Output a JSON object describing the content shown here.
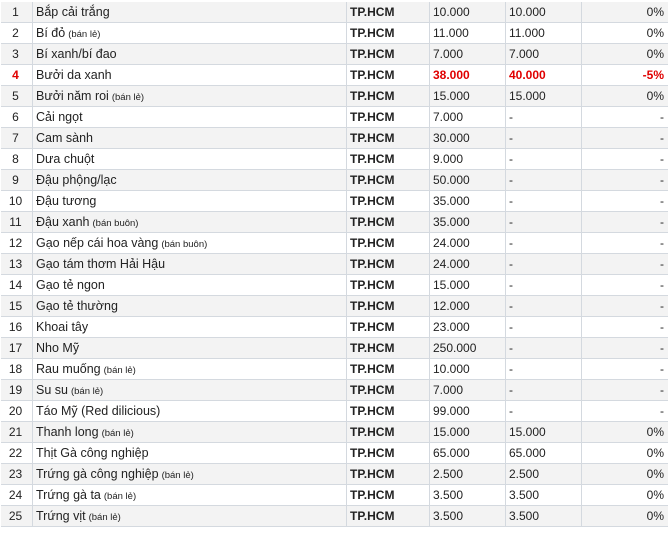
{
  "table": {
    "rows": [
      {
        "idx": "1",
        "name": "Bắp cải trắng",
        "note": "",
        "loc": "TP.HCM",
        "price1": "10.000",
        "price2": "10.000",
        "change": "0%"
      },
      {
        "idx": "2",
        "name": "Bí đỏ",
        "note": "(bán lẻ)",
        "loc": "TP.HCM",
        "price1": "11.000",
        "price2": "11.000",
        "change": "0%"
      },
      {
        "idx": "3",
        "name": "Bí xanh/bí đao",
        "note": "",
        "loc": "TP.HCM",
        "price1": "7.000",
        "price2": "7.000",
        "change": "0%"
      },
      {
        "idx": "4",
        "name": "Bưởi da xanh",
        "note": "",
        "loc": "TP.HCM",
        "price1": "38.000",
        "price2": "40.000",
        "change": "-5%",
        "highlight": true
      },
      {
        "idx": "5",
        "name": "Bưởi năm roi",
        "note": "(bán lẻ)",
        "loc": "TP.HCM",
        "price1": "15.000",
        "price2": "15.000",
        "change": "0%"
      },
      {
        "idx": "6",
        "name": "Cải ngọt",
        "note": "",
        "loc": "TP.HCM",
        "price1": "7.000",
        "price2": "-",
        "change": "-"
      },
      {
        "idx": "7",
        "name": "Cam sành",
        "note": "",
        "loc": "TP.HCM",
        "price1": "30.000",
        "price2": "-",
        "change": "-"
      },
      {
        "idx": "8",
        "name": "Dưa chuột",
        "note": "",
        "loc": "TP.HCM",
        "price1": "9.000",
        "price2": "-",
        "change": "-"
      },
      {
        "idx": "9",
        "name": "Đậu phộng/lạc",
        "note": "",
        "loc": "TP.HCM",
        "price1": "50.000",
        "price2": "-",
        "change": "-"
      },
      {
        "idx": "10",
        "name": "Đậu tương",
        "note": "",
        "loc": "TP.HCM",
        "price1": "35.000",
        "price2": "-",
        "change": "-"
      },
      {
        "idx": "11",
        "name": "Đậu xanh",
        "note": "(bán buôn)",
        "loc": "TP.HCM",
        "price1": "35.000",
        "price2": "-",
        "change": "-"
      },
      {
        "idx": "12",
        "name": "Gạo nếp cái hoa vàng",
        "note": "(bán buôn)",
        "loc": "TP.HCM",
        "price1": "24.000",
        "price2": "-",
        "change": "-"
      },
      {
        "idx": "13",
        "name": "Gạo tám thơm Hải Hậu",
        "note": "",
        "loc": "TP.HCM",
        "price1": "24.000",
        "price2": "-",
        "change": "-"
      },
      {
        "idx": "14",
        "name": "Gạo tẻ ngon",
        "note": "",
        "loc": "TP.HCM",
        "price1": "15.000",
        "price2": "-",
        "change": "-"
      },
      {
        "idx": "15",
        "name": "Gạo tẻ thường",
        "note": "",
        "loc": "TP.HCM",
        "price1": "12.000",
        "price2": "-",
        "change": "-"
      },
      {
        "idx": "16",
        "name": "Khoai tây",
        "note": "",
        "loc": "TP.HCM",
        "price1": "23.000",
        "price2": "-",
        "change": "-"
      },
      {
        "idx": "17",
        "name": "Nho Mỹ",
        "note": "",
        "loc": "TP.HCM",
        "price1": "250.000",
        "price2": "-",
        "change": "-"
      },
      {
        "idx": "18",
        "name": "Rau muống",
        "note": "(bán lẻ)",
        "loc": "TP.HCM",
        "price1": "10.000",
        "price2": "-",
        "change": "-"
      },
      {
        "idx": "19",
        "name": "Su su",
        "note": "(bán lẻ)",
        "loc": "TP.HCM",
        "price1": "7.000",
        "price2": "-",
        "change": "-"
      },
      {
        "idx": "20",
        "name": "Táo Mỹ (Red dilicious)",
        "note": "",
        "loc": "TP.HCM",
        "price1": "99.000",
        "price2": "-",
        "change": "-"
      },
      {
        "idx": "21",
        "name": "Thanh long",
        "note": "(bán lẻ)",
        "loc": "TP.HCM",
        "price1": "15.000",
        "price2": "15.000",
        "change": "0%"
      },
      {
        "idx": "22",
        "name": "Thịt Gà công nghiệp",
        "note": "",
        "loc": "TP.HCM",
        "price1": "65.000",
        "price2": "65.000",
        "change": "0%"
      },
      {
        "idx": "23",
        "name": "Trứng gà công nghiệp",
        "note": "(bán lẻ)",
        "loc": "TP.HCM",
        "price1": "2.500",
        "price2": "2.500",
        "change": "0%"
      },
      {
        "idx": "24",
        "name": "Trứng gà ta",
        "note": "(bán lẻ)",
        "loc": "TP.HCM",
        "price1": "3.500",
        "price2": "3.500",
        "change": "0%"
      },
      {
        "idx": "25",
        "name": "Trứng vịt",
        "note": "(bán lẻ)",
        "loc": "TP.HCM",
        "price1": "3.500",
        "price2": "3.500",
        "change": "0%"
      }
    ]
  },
  "colors": {
    "row_odd": "#f3f3f3",
    "row_even": "#ffffff",
    "grid": "#d4d9df",
    "highlight": "#e00000"
  }
}
